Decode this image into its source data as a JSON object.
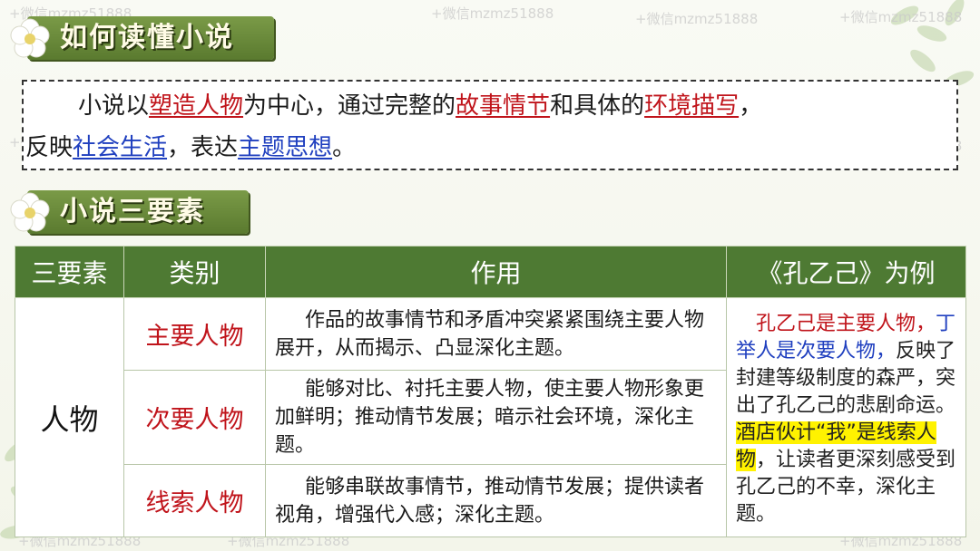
{
  "watermark": "+微信mzmz51888",
  "section1": {
    "title": "如何读懂小说"
  },
  "intro": {
    "line1": {
      "t1": "小说以",
      "k1": "塑造人物",
      "t2": "为中心，通过完整的",
      "k2": "故事情节",
      "t3": "和具体的",
      "k3": "环境描写",
      "t4": "，"
    },
    "line2": {
      "t1": "反映",
      "k1": "社会生活",
      "t2": "，表达",
      "k2": "主题思想",
      "t3": "。"
    }
  },
  "section2": {
    "title": "小说三要素"
  },
  "table": {
    "headers": [
      "三要素",
      "类别",
      "作用",
      "《孔乙己》为例"
    ],
    "element": "人物",
    "rows": [
      {
        "category": "主要人物",
        "desc": "作品的故事情节和矛盾冲突紧紧围绕主要人物展开，从而揭示、凸显深化主题。"
      },
      {
        "category": "次要人物",
        "desc": "能够对比、衬托主要人物，使主要人物形象更加鲜明；推动情节发展；暗示社会环境，深化主题。"
      },
      {
        "category": "线索人物",
        "desc": "能够串联故事情节，推动情节发展；提供读者视角，增强代入感；深化主题。"
      }
    ],
    "example": {
      "p1": "孔乙己是主要人物，",
      "p2": "丁举人是次要人物，",
      "p3": "反映了封建等级制度的森严，突出了孔乙己的悲剧命运。",
      "p4": "酒店伙计“我”是线索人物",
      "p5": "，让读者更深刻感受到孔乙己的不幸，深化主题。"
    }
  },
  "colors": {
    "accent_green": "#4e7a33",
    "keyword_red": "#c0141b",
    "keyword_blue": "#1f3fbf",
    "highlight": "#fff200"
  }
}
